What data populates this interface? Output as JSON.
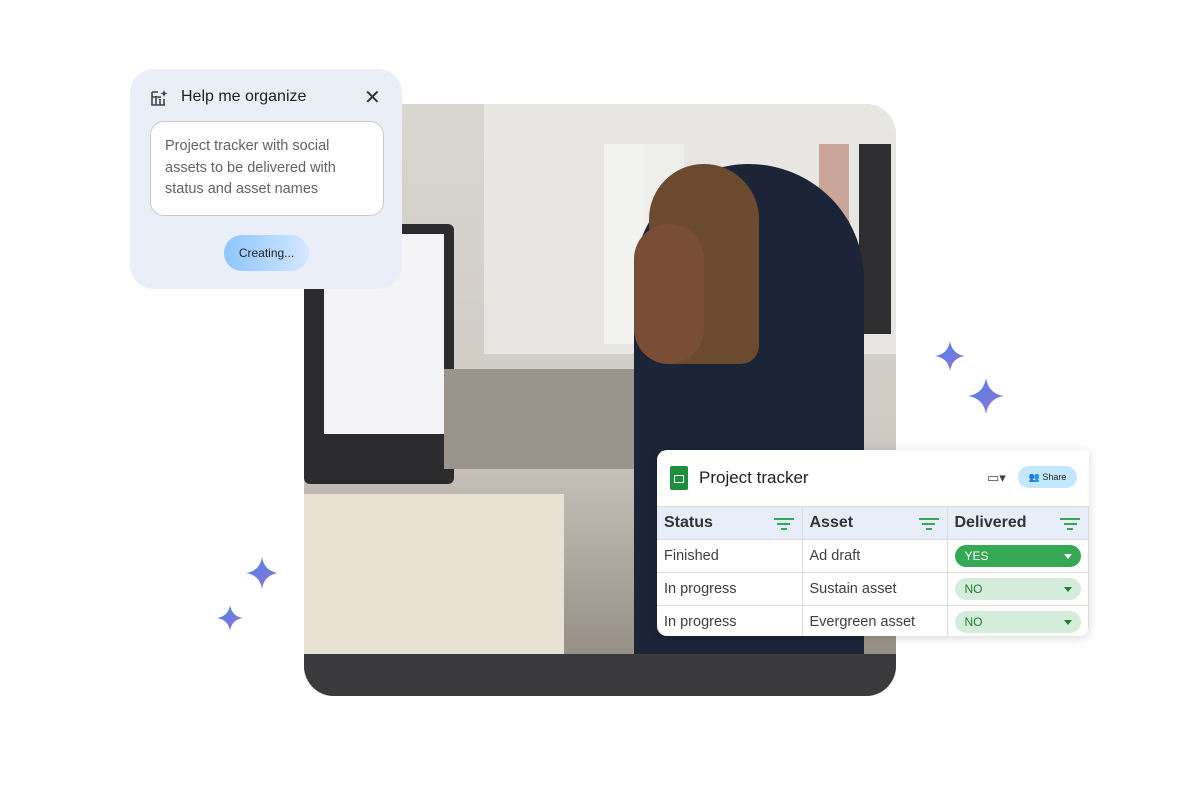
{
  "organize_card": {
    "title": "Help me organize",
    "close_icon": "close-icon",
    "prompt_text": "Project tracker with social assets to be delivered with status and asset names",
    "button_label": "Creating..."
  },
  "sheet": {
    "title": "Project tracker",
    "share_label": "Share",
    "columns": [
      "Status",
      "Asset",
      "Delivered"
    ],
    "rows": [
      {
        "status": "Finished",
        "asset": "Ad draft",
        "delivered": "YES"
      },
      {
        "status": "In progress",
        "asset": "Sustain asset",
        "delivered": "NO"
      },
      {
        "status": "In progress",
        "asset": "Evergreen asset",
        "delivered": "NO"
      }
    ],
    "colors": {
      "yes": "#34a853",
      "no": "#d4edda"
    }
  }
}
